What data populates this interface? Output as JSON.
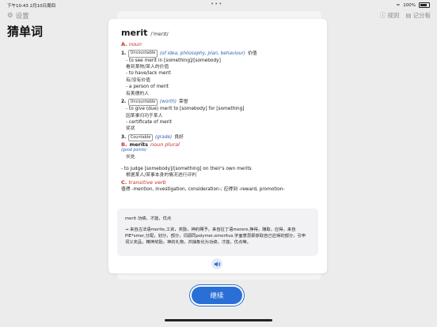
{
  "status": {
    "time": "下午10:43",
    "date": "2月10日周四",
    "dots": "•••",
    "battery": "100%"
  },
  "header": {
    "settings_label": "设置",
    "title": "猜单词",
    "rules_label": "规则",
    "log_label": "记分板"
  },
  "entry": {
    "word": "merit",
    "phonetic": "/ˈmerɪt/",
    "pos_a_letter": "A.",
    "pos_a": "noun",
    "s1_num": "1.",
    "s1_tag": "Uncountable",
    "s1_gloss": "(of idea, philosophy, plan, behaviour)",
    "s1_cn": "价值",
    "l1": "- to see merit in [something]/[somebody]",
    "l1_cn": "看到某物/某人的价值",
    "l2": "- to have/lack merit",
    "l2_cn": "有/没有价值",
    "l3": "- a person of merit",
    "l3_cn": "有美德的人",
    "s2_num": "2.",
    "s2_tag": "Uncountable",
    "s2_gloss": "(worth)",
    "s2_cn": "荣誉",
    "l4": "- to give (due) merit to [somebody] for [something]",
    "l4_cn": "因某事归功于某人",
    "l5": "- certificate of merit",
    "l5_cn": "奖状",
    "s3_num": "3.",
    "s3_tag": "Countable",
    "s3_gloss": "(grade)",
    "s3_cn": "良好",
    "pos_b_letter": "B.",
    "pos_b_word": "merits",
    "pos_b": "noun plural",
    "good_points": "(good points)",
    "good_cn": "长处",
    "l6": "- to judge [somebody]/[something] on their's own merits",
    "l6_cn": "根据某人/某事本身的情况进行评判",
    "pos_c_letter": "C.",
    "pos_c": "transitive verb",
    "verb_line": "值得 -mention, investigation, consideration-; 应得到 -reward, promotion-"
  },
  "etymology": {
    "summary": "merit 功绩，才能，优点",
    "line1": "→ 来自古法语merite,工资，奖励，神的赐予，来自拉丁语merere,挣得，赚取，应得，来自",
    "line2": "PIE*smer,分配，划分，部分，词源同polymer,emeritus.字面意思即获取自己应得的部分，引申",
    "line3": "词义奖品，精神奖励，神的礼物，并抽象化为功绩，才能，优点等。"
  },
  "continue_label": "继续"
}
